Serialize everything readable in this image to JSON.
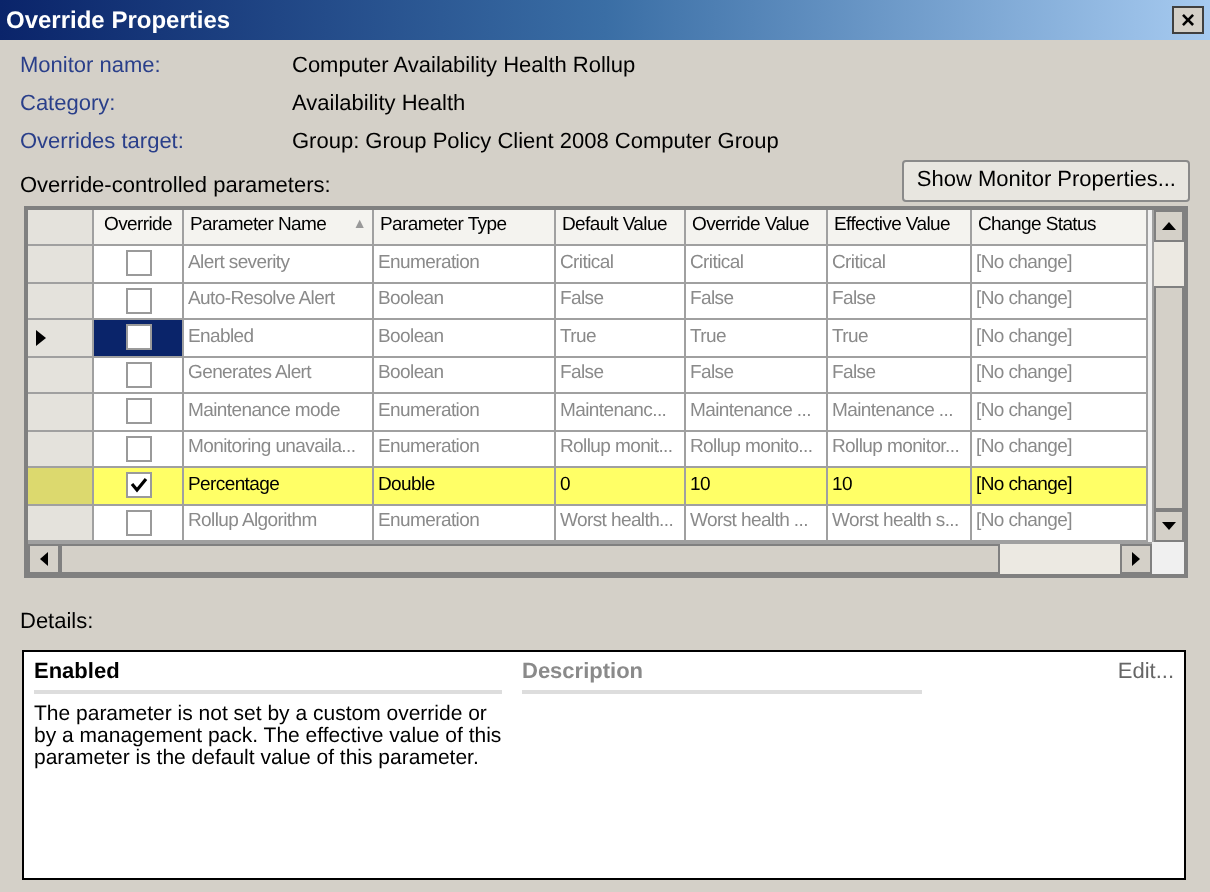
{
  "window": {
    "title": "Override Properties",
    "close": "×"
  },
  "info": [
    {
      "label": "Monitor name:",
      "value": "Computer Availability Health Rollup"
    },
    {
      "label": "Category:",
      "value": "Availability Health"
    },
    {
      "label": "Overrides target:",
      "value": "Group: Group Policy Client 2008 Computer Group"
    }
  ],
  "grid_label": "Override-controlled parameters:",
  "show_button": "Show Monitor Properties...",
  "table": {
    "override_column": "Override",
    "columns": [
      "Parameter Name",
      "Parameter Type",
      "Default Value",
      "Override Value",
      "Effective Value",
      "Change Status"
    ],
    "sort_mark": "▲",
    "rows": [
      {
        "checked": false,
        "selected": false,
        "cells": [
          "Alert severity",
          "Enumeration",
          "Critical",
          "Critical",
          "Critical",
          "[No change]"
        ]
      },
      {
        "checked": false,
        "selected": false,
        "cells": [
          "Auto-Resolve Alert",
          "Boolean",
          "False",
          "False",
          "False",
          "[No change]"
        ]
      },
      {
        "checked": false,
        "selected": true,
        "cells": [
          "Enabled",
          "Boolean",
          "True",
          "True",
          "True",
          "[No change]"
        ]
      },
      {
        "checked": false,
        "selected": false,
        "cells": [
          "Generates Alert",
          "Boolean",
          "False",
          "False",
          "False",
          "[No change]"
        ]
      },
      {
        "checked": false,
        "selected": false,
        "cells": [
          "Maintenance mode",
          "Enumeration",
          "Maintenanc...",
          "Maintenance ...",
          "Maintenance ...",
          "[No change]"
        ]
      },
      {
        "checked": false,
        "selected": false,
        "cells": [
          "Monitoring unavaila...",
          "Enumeration",
          "Rollup monit...",
          "Rollup monito...",
          "Rollup monitor...",
          "[No change]"
        ]
      },
      {
        "checked": true,
        "selected": false,
        "cells": [
          "Percentage",
          "Double",
          "0",
          "10",
          "10",
          "[No change]"
        ]
      },
      {
        "checked": false,
        "selected": false,
        "cells": [
          "Rollup Algorithm",
          "Enumeration",
          "Worst health...",
          "Worst health ...",
          "Worst health s...",
          "[No change]"
        ]
      }
    ]
  },
  "details": {
    "label": "Details:",
    "title": "Enabled",
    "description_heading": "Description",
    "edit": "Edit...",
    "text": "The parameter is not set by a custom override or by a management pack. The effective value of this parameter is the default value of this parameter."
  }
}
